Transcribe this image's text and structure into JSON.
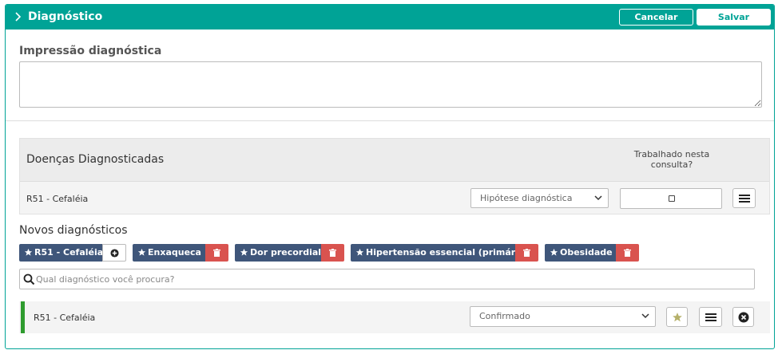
{
  "header": {
    "title": "Diagnóstico",
    "cancel_label": "Cancelar",
    "save_label": "Salvar",
    "icon": "chevron-right-icon"
  },
  "impressao": {
    "label": "Impressão diagnóstica",
    "value": ""
  },
  "doencas": {
    "title": "Doenças Diagnosticadas",
    "column_label": "Trabalhado nesta consulta?",
    "rows": [
      {
        "label": "R51 - Cefaléia",
        "select_value": "Hipótese diagnóstica",
        "worked": false
      }
    ]
  },
  "novos": {
    "label": "Novos diagnósticos",
    "tags": [
      {
        "label": "R51 - Cefaléia",
        "action": "add"
      },
      {
        "label": "Enxaqueca",
        "action": "delete"
      },
      {
        "label": "Dor precordial",
        "action": "delete"
      },
      {
        "label": "Hipertensão essencial (primária)",
        "action": "delete"
      },
      {
        "label": "Obesidade",
        "action": "delete"
      }
    ],
    "search_placeholder": "Qual diagnóstico você procura?",
    "selected": {
      "label": "R51 - Cefaléia",
      "select_value": "Confirmado"
    }
  },
  "colors": {
    "primary": "#00a396",
    "tag": "#3f567a",
    "delete": "#d9534f",
    "confirmed_bar": "#2e9c2e",
    "star": "#b5b06a"
  }
}
